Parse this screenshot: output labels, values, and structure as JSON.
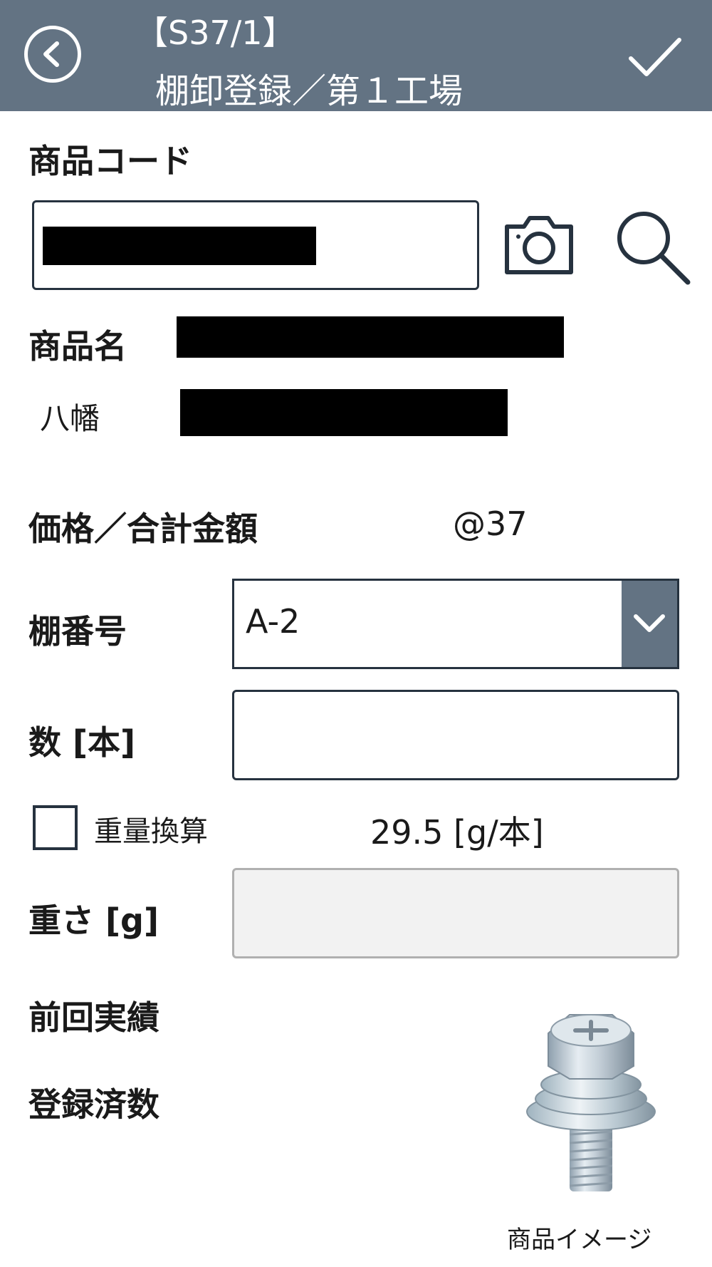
{
  "header": {
    "title_line1": "【S37/1】",
    "title_line2": "棚卸登録／第１工場",
    "back_icon": "chevron-left-circle-icon",
    "confirm_icon": "checkmark-icon"
  },
  "product_code": {
    "label": "商品コード",
    "value": "",
    "camera_icon": "camera-icon",
    "search_icon": "search-icon"
  },
  "product_name": {
    "label": "商品名",
    "value": ""
  },
  "maker": {
    "label": "八幡",
    "value": ""
  },
  "price": {
    "label": "価格／合計金額",
    "value": "@37"
  },
  "shelf": {
    "label": "棚番号",
    "selected": "A-2",
    "dropdown_icon": "chevron-down-icon"
  },
  "quantity": {
    "label": "数 [本]",
    "value": ""
  },
  "weight_conversion": {
    "label": "重量換算",
    "checked": false,
    "unit_weight": "29.5 [g/本]"
  },
  "weight": {
    "label": "重さ [g]",
    "value": ""
  },
  "previous_record": {
    "label": "前回実績"
  },
  "registered_count": {
    "label": "登録済数"
  },
  "product_image": {
    "caption": "商品イメージ",
    "icon": "bolt-image"
  },
  "colors": {
    "header_bg": "#637383",
    "border": "#26323f",
    "disabled_bg": "#f2f2f2"
  }
}
